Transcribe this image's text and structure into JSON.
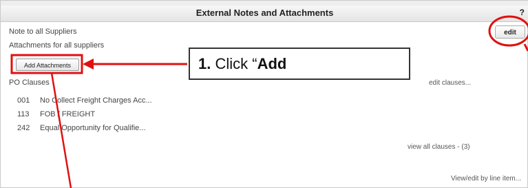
{
  "panel": {
    "title": "External Notes and Attachments",
    "help": "?",
    "edit_label": "edit",
    "note_label": "Note to all Suppliers",
    "attachments_label": "Attachments for all suppliers",
    "add_attachments_label": "Add Attachments",
    "po_clauses_label": "PO Clauses",
    "edit_clauses_link": "edit clauses...",
    "clauses": [
      {
        "code": "001",
        "text": "No Collect Freight Charges Acc..."
      },
      {
        "code": "113",
        "text": "FOB / FREIGHT"
      },
      {
        "code": "242",
        "text": "Equal Opportunity for Qualifie..."
      }
    ],
    "view_all_clauses_link": "view all clauses - (3)",
    "view_edit_line_item_link": "View/edit by line item..."
  },
  "callout": {
    "step": "1.",
    "text_prefix": " Click “",
    "text_bold": "Add"
  },
  "colors": {
    "annotation_red": "#e01010",
    "header_bg": "#e8e8e8"
  }
}
